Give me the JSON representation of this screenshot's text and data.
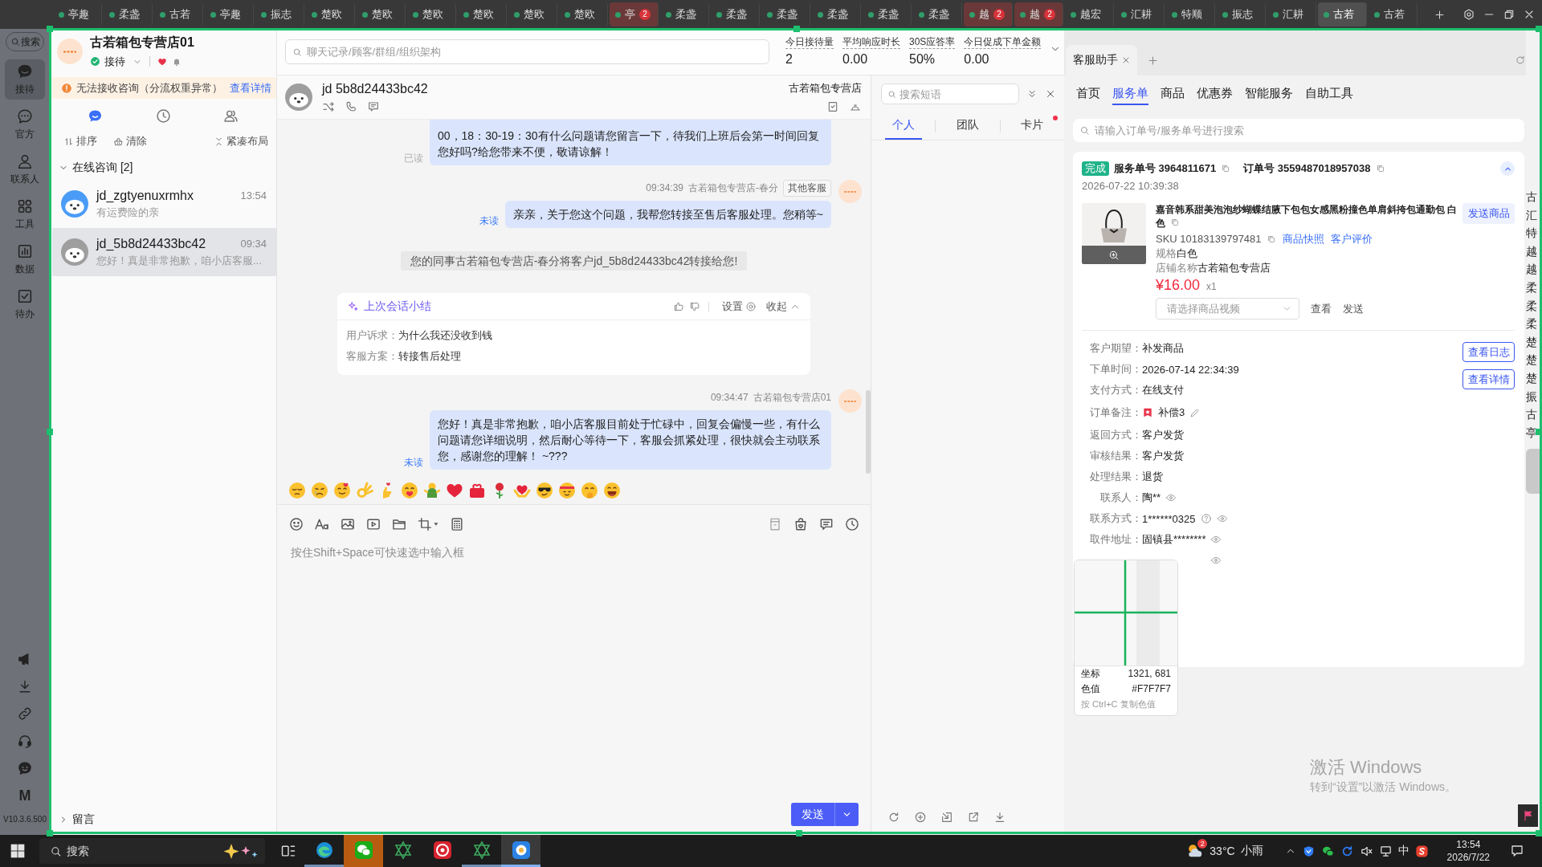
{
  "top_tabs": [
    {
      "label": "亭趣",
      "selected": false,
      "alert": false
    },
    {
      "label": "柔盏",
      "selected": false,
      "alert": false
    },
    {
      "label": "古若",
      "selected": false,
      "alert": false
    },
    {
      "label": "亭趣",
      "selected": false,
      "alert": false
    },
    {
      "label": "振志",
      "selected": false,
      "alert": false
    },
    {
      "label": "楚欧",
      "selected": false,
      "alert": false
    },
    {
      "label": "楚欧",
      "selected": false,
      "alert": false
    },
    {
      "label": "楚欧",
      "selected": false,
      "alert": false
    },
    {
      "label": "楚欧",
      "selected": false,
      "alert": false
    },
    {
      "label": "楚欧",
      "selected": false,
      "alert": false
    },
    {
      "label": "楚欧",
      "selected": false,
      "alert": false
    },
    {
      "label": "亭",
      "selected": false,
      "alert": true,
      "badge": "2"
    },
    {
      "label": "柔盏",
      "selected": false,
      "alert": false
    },
    {
      "label": "柔盏",
      "selected": false,
      "alert": false
    },
    {
      "label": "柔盏",
      "selected": false,
      "alert": false
    },
    {
      "label": "柔盏",
      "selected": false,
      "alert": false
    },
    {
      "label": "柔盏",
      "selected": false,
      "alert": false
    },
    {
      "label": "柔盏",
      "selected": false,
      "alert": false
    },
    {
      "label": "越",
      "selected": false,
      "alert": true,
      "badge": "2"
    },
    {
      "label": "越",
      "selected": false,
      "alert": true,
      "badge": "2"
    },
    {
      "label": "越宏",
      "selected": false,
      "alert": false
    },
    {
      "label": "汇耕",
      "selected": false,
      "alert": false
    },
    {
      "label": "特顺",
      "selected": false,
      "alert": false
    },
    {
      "label": "振志",
      "selected": false,
      "alert": false
    },
    {
      "label": "汇耕",
      "selected": false,
      "alert": false
    },
    {
      "label": "古若",
      "selected": true,
      "alert": false
    },
    {
      "label": "古若",
      "selected": false,
      "alert": false
    }
  ],
  "sidebar": {
    "search": "搜索",
    "items": [
      {
        "label": "接待",
        "selected": true
      },
      {
        "label": "官方",
        "selected": false
      },
      {
        "label": "联系人",
        "selected": false
      },
      {
        "label": "工具",
        "selected": false
      },
      {
        "label": "数据",
        "selected": false
      },
      {
        "label": "待办",
        "selected": false
      }
    ],
    "logo": "M",
    "version": "V10.3.6.500"
  },
  "inbox": {
    "shop": {
      "name": "古若箱包专营店01",
      "status": "接待"
    },
    "notice": {
      "text": "无法接收咨询（分流权重异常）",
      "link": "查看详情"
    },
    "tabs": [
      {
        "selected": true
      },
      {
        "selected": false
      },
      {
        "selected": false
      }
    ],
    "actions": [
      "排序",
      "清除",
      "紧凑布局"
    ],
    "section": {
      "title": "在线咨询 [2]",
      "expanded": true
    },
    "conversations": [
      {
        "name": "jd_zgtyenuxrmhx",
        "time": "13:54",
        "preview": "有运费险的亲",
        "color": "#4a9cf6",
        "selected": false
      },
      {
        "name": "jd_5b8d24433bc42",
        "time": "09:34",
        "preview": "您好！真是非常抱歉，咱小店客服...",
        "color": "#9e9e9e",
        "selected": true
      }
    ],
    "footer": {
      "title": "留言",
      "expanded": false
    }
  },
  "chat": {
    "search": {
      "placeholder": "聊天记录/顾客/群组/组织架构"
    },
    "stats": [
      {
        "label": "今日接待量",
        "value": "2"
      },
      {
        "label": "平均响应时长",
        "value": "0.00"
      },
      {
        "label": "30S应答率",
        "value": "50%"
      },
      {
        "label": "今日促成下单金额",
        "value": "0.00"
      }
    ],
    "header": {
      "name": "jd 5b8d24433bc42",
      "shop": "古若箱包专营店"
    },
    "messages": [
      {
        "kind": "outgoing",
        "text": "00，18：30-19：30有什么问题请您留言一下，待我们上班后会第一时间回复您好吗?给您带来不便，敬请谅解！",
        "status": "已读",
        "read": true
      },
      {
        "kind": "outgoing",
        "time": "09:34:39",
        "sender": "古若箱包专营店-春分",
        "tag": "其他客服",
        "text": "亲亲，关于您这个问题，我帮您转接至售后客服处理。您稍等~",
        "status": "未读",
        "read": false
      },
      {
        "kind": "system",
        "text": "您的同事古若箱包专营店-春分将客户jd_5b8d24433bc42转接给您!"
      },
      {
        "kind": "summary",
        "title": "上次会话小结",
        "settings": "设置",
        "collapse": "收起",
        "rows": [
          {
            "label": "用户诉求：",
            "value": "为什么我还没收到钱"
          },
          {
            "label": "客服方案：",
            "value": "转接售后处理"
          }
        ]
      },
      {
        "kind": "outgoing",
        "time": "09:34:47",
        "sender": "古若箱包专营店01",
        "text": "您好！真是非常抱歉，咱小店客服目前处于忙碌中，回复会偏慢一些，有什么问题请您详细说明，然后耐心等待一下，客服会抓紧处理，很快就会主动联系您，感谢您的理解！ ~???",
        "status": "未读",
        "read": false
      }
    ],
    "composer": {
      "placeholder": "按住Shift+Space可快速选中输入框",
      "send": "发送"
    }
  },
  "quick_replies": {
    "search": {
      "placeholder": "搜索短语"
    },
    "tabs": [
      {
        "label": "个人",
        "selected": true,
        "dot": false
      },
      {
        "label": "团队",
        "selected": false,
        "dot": false
      },
      {
        "label": "卡片",
        "selected": false,
        "dot": true
      }
    ]
  },
  "assistant": {
    "tab": "客服助手",
    "nav": [
      {
        "label": "首页",
        "selected": false
      },
      {
        "label": "服务单",
        "selected": true
      },
      {
        "label": "商品",
        "selected": false
      },
      {
        "label": "优惠券",
        "selected": false
      },
      {
        "label": "智能服务",
        "selected": false
      },
      {
        "label": "自助工具",
        "selected": false
      }
    ],
    "search": {
      "placeholder": "请输入订单号/服务单号进行搜索"
    },
    "order": {
      "status": "完成",
      "expanded": true,
      "service_no": "服务单号 3964811671",
      "order_no": "订单号 3559487018957038",
      "date": "2026-07-22 10:39:38",
      "product": {
        "title": "嘉音韩系甜美泡泡纱蝴蝶结腋下包包女感黑粉撞色单肩斜挎包通勤包 白色",
        "send": "发送商品",
        "sku": "SKU 10183139797481",
        "links": [
          "商品快照",
          "客户评价"
        ],
        "spec_label": "规格",
        "spec": "白色",
        "shop_label": "店铺名称",
        "shop": "古若箱包专营店",
        "price": "¥16.00",
        "quantity": "x1",
        "video_placeholder": "请选择商品视频",
        "video_actions": [
          "查看",
          "发送"
        ]
      },
      "details": [
        {
          "kind": "text",
          "label": "客户期望：",
          "value": "补发商品"
        },
        {
          "kind": "text",
          "label": "下单时间：",
          "value": "2026-07-14 22:34:39"
        },
        {
          "kind": "text",
          "label": "支付方式：",
          "value": "在线支付"
        },
        {
          "kind": "note",
          "label": "订单备注：",
          "value": "补偿3"
        },
        {
          "kind": "text",
          "label": "返回方式：",
          "value": "客户发货"
        },
        {
          "kind": "text",
          "label": "审核结果：",
          "value": "客户发货"
        },
        {
          "kind": "text",
          "label": "处理结果：",
          "value": "退货"
        },
        {
          "kind": "masked",
          "label": "联系人：",
          "value": "陶**"
        },
        {
          "kind": "phone",
          "label": "联系方式：",
          "value": "1******0325"
        },
        {
          "kind": "masked",
          "label": "取件地址：",
          "value": "固镇县********"
        },
        {
          "kind": "covered"
        }
      ],
      "buttons": [
        "查看日志",
        "查看详情"
      ]
    }
  },
  "edge_tabs": [
    "古",
    "汇",
    "特",
    "越",
    "越",
    "柔",
    "柔",
    "柔",
    "楚",
    "楚",
    "楚",
    "振",
    "古",
    "亭"
  ],
  "color_picker": {
    "coord_label": "坐标",
    "coord": "1321, 681",
    "value_label": "色值",
    "value": "#F7F7F7",
    "hint": "按 Ctrl+C 复制色值"
  },
  "activation": {
    "title": "激活 Windows",
    "subtitle": "转到“设置”以激活 Windows。"
  },
  "taskbar": {
    "search": {
      "placeholder": "搜索"
    },
    "apps": [
      {
        "selected": false,
        "running": true,
        "attention": false
      },
      {
        "selected": false,
        "running": false,
        "attention": true
      },
      {
        "selected": false,
        "running": false,
        "attention": false
      },
      {
        "selected": false,
        "running": false,
        "attention": false
      },
      {
        "selected": false,
        "running": true,
        "attention": false
      },
      {
        "selected": true,
        "running": true,
        "attention": false
      }
    ],
    "weather": {
      "temperature": "33°C",
      "condition": "小雨",
      "badge": "2"
    },
    "ime": "中",
    "time": "13:54",
    "date": "2026/7/22"
  }
}
